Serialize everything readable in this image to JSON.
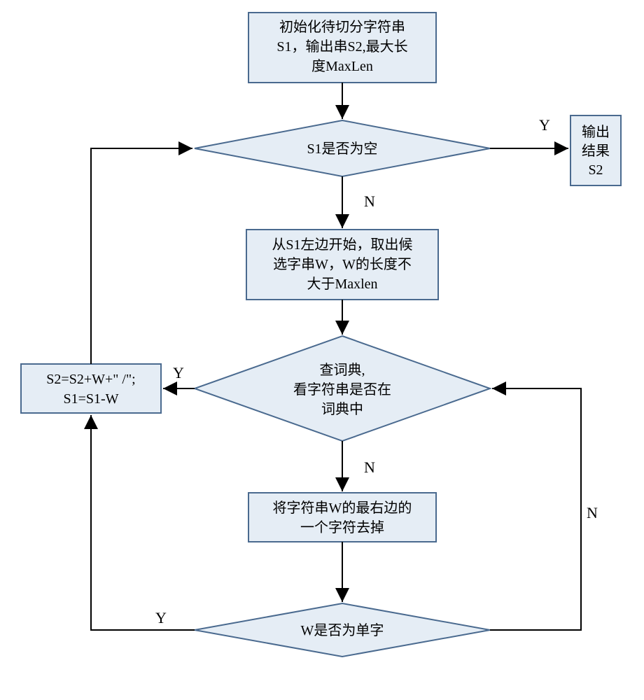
{
  "chart_data": {
    "type": "flowchart",
    "nodes": [
      {
        "id": "n1",
        "shape": "rect",
        "lines": [
          "初始化待切分字符串",
          "S1，输出串S2,最大长",
          "度MaxLen"
        ]
      },
      {
        "id": "n2",
        "shape": "diamond",
        "lines": [
          "S1是否为空"
        ]
      },
      {
        "id": "n3",
        "shape": "rect",
        "lines": [
          "输出",
          "结果",
          "S2"
        ]
      },
      {
        "id": "n4",
        "shape": "rect",
        "lines": [
          "从S1左边开始，取出候",
          "选字串W，W的长度不",
          "大于Maxlen"
        ]
      },
      {
        "id": "n5",
        "shape": "diamond",
        "lines": [
          "查词典,",
          "看字符串是否在",
          "词典中"
        ]
      },
      {
        "id": "n6",
        "shape": "rect",
        "lines": [
          "S2=S2+W+\" /\";",
          "S1=S1-W"
        ]
      },
      {
        "id": "n7",
        "shape": "rect",
        "lines": [
          "将字符串W的最右边的",
          "一个字符去掉"
        ]
      },
      {
        "id": "n8",
        "shape": "diamond",
        "lines": [
          "W是否为单字"
        ]
      }
    ],
    "edges": [
      {
        "from": "n1",
        "to": "n2",
        "label": ""
      },
      {
        "from": "n2",
        "to": "n3",
        "label": "Y"
      },
      {
        "from": "n2",
        "to": "n4",
        "label": "N"
      },
      {
        "from": "n4",
        "to": "n5",
        "label": ""
      },
      {
        "from": "n5",
        "to": "n6",
        "label": "Y"
      },
      {
        "from": "n5",
        "to": "n7",
        "label": "N"
      },
      {
        "from": "n7",
        "to": "n8",
        "label": ""
      },
      {
        "from": "n8",
        "to": "n6",
        "label": "Y"
      },
      {
        "from": "n8",
        "to": "n5",
        "label": "N"
      },
      {
        "from": "n6",
        "to": "n2",
        "label": ""
      }
    ]
  },
  "labels": {
    "Y": "Y",
    "N": "N"
  }
}
